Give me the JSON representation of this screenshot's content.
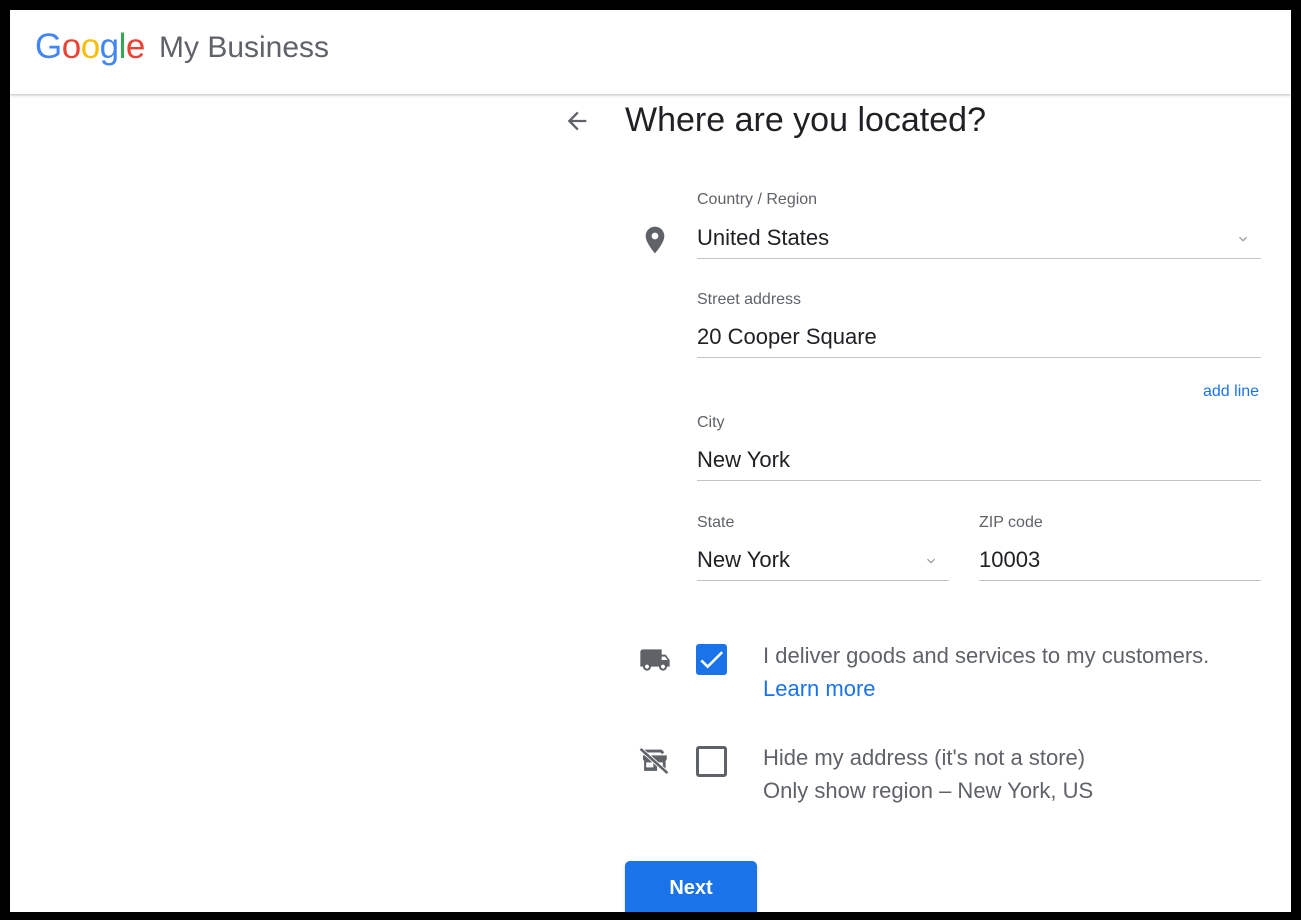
{
  "header": {
    "logo_letters": [
      {
        "char": "G",
        "color": "#4285f4"
      },
      {
        "char": "o",
        "color": "#ea4335"
      },
      {
        "char": "o",
        "color": "#fbbc05"
      },
      {
        "char": "g",
        "color": "#4285f4"
      },
      {
        "char": "l",
        "color": "#34a853"
      },
      {
        "char": "e",
        "color": "#ea4335"
      }
    ],
    "product_name": "My Business"
  },
  "page": {
    "back_icon": "arrow-back-icon",
    "title": "Where are you located?"
  },
  "form": {
    "location_icon": "location-pin-icon",
    "country": {
      "label": "Country / Region",
      "value": "United States",
      "icon": "chevron-down-icon"
    },
    "street": {
      "label": "Street address",
      "value": "20 Cooper Square"
    },
    "add_line": "add line",
    "city": {
      "label": "City",
      "value": "New York"
    },
    "state": {
      "label": "State",
      "value": "New York",
      "icon": "chevron-down-icon"
    },
    "zip": {
      "label": "ZIP code",
      "value": "10003"
    }
  },
  "options": {
    "deliver": {
      "icon": "delivery-truck-icon",
      "checked": true,
      "text": "I deliver goods and services to my customers.",
      "learn_more": "Learn more"
    },
    "hide_address": {
      "icon": "store-off-icon",
      "checked": false,
      "text": "Hide my address (it's not a store)",
      "subtext": "Only show region – New York, US"
    }
  },
  "actions": {
    "next_label": "Next"
  },
  "colors": {
    "accent": "#1a73e8",
    "text_primary": "#202124",
    "text_secondary": "#5f6368"
  }
}
